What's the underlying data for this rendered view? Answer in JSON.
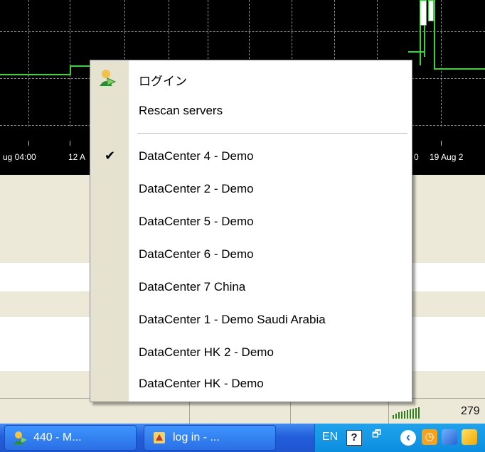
{
  "chart": {
    "time_labels": [
      "ug 04:00",
      "12 A",
      "0",
      "19 Aug 2"
    ]
  },
  "context_menu": {
    "items": [
      {
        "label": "ログイン",
        "icon": "login-user-icon",
        "checked": false
      },
      {
        "label": "Rescan servers",
        "checked": false
      },
      {
        "label": "DataCenter 4 - Demo",
        "checked": true
      },
      {
        "label": "DataCenter 2 - Demo",
        "checked": false
      },
      {
        "label": "DataCenter 5 - Demo",
        "checked": false
      },
      {
        "label": "DataCenter 6 - Demo",
        "checked": false
      },
      {
        "label": "DataCenter 7 China",
        "checked": false
      },
      {
        "label": "DataCenter 1  - Demo Saudi Arabia",
        "checked": false
      },
      {
        "label": "DataCenter HK 2 - Demo",
        "checked": false
      },
      {
        "label": "DataCenter HK - Demo",
        "checked": false
      }
    ],
    "check_glyph": "✔"
  },
  "status_bar": {
    "connection_icon": "signal-bars-icon",
    "traffic_text": "279"
  },
  "taskbar": {
    "buttons": [
      {
        "label": "440 - M...",
        "icon": "user-icon"
      },
      {
        "label": "log in - ...",
        "icon": "tool-icon"
      }
    ],
    "tray": {
      "language": "EN",
      "help_glyph": "?",
      "restore_glyph": "🗗",
      "chevron_glyph": "‹",
      "clock_glyph": "◷"
    }
  },
  "colors": {
    "chart_background": "#000000",
    "chart_line": "#33d633",
    "menu_check": "#000000",
    "taskbar_blue": "#245edb"
  }
}
